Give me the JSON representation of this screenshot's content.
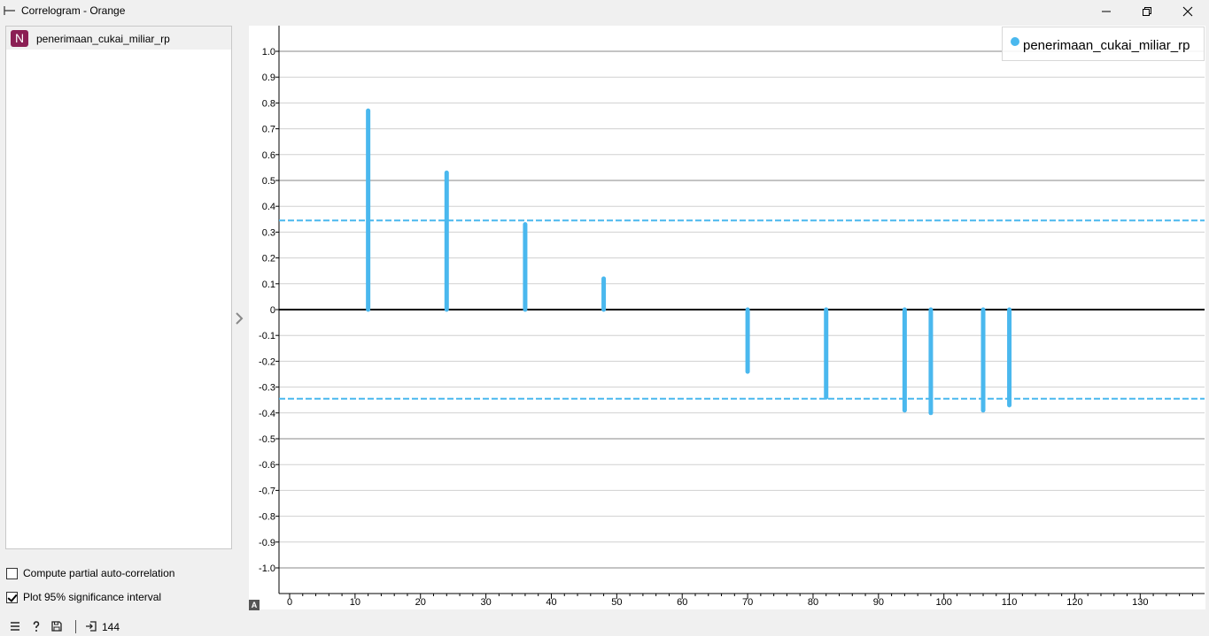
{
  "window": {
    "title": "Correlogram - Orange"
  },
  "sidebar": {
    "variables": [
      {
        "badge": "N",
        "label": "penerimaan_cukai_miliar_rp"
      }
    ],
    "options": [
      {
        "label": "Compute partial auto-correlation",
        "checked": false
      },
      {
        "label": "Plot 95% significance interval",
        "checked": true
      }
    ]
  },
  "legend": {
    "label": "penerimaan_cukai_miliar_rp",
    "color": "#4ab8ee"
  },
  "statusbar": {
    "count": "144"
  },
  "chart_data": {
    "type": "bar",
    "series": [
      {
        "name": "penerimaan_cukai_miliar_rp",
        "x": [
          12,
          24,
          36,
          48,
          70,
          82,
          94,
          98,
          106,
          110
        ],
        "values": [
          0.77,
          0.53,
          0.33,
          0.12,
          -0.24,
          -0.34,
          -0.39,
          -0.4,
          -0.39,
          -0.37
        ]
      }
    ],
    "significance": 0.345,
    "xlim": [
      -2,
      139
    ],
    "ylim": [
      -1.1,
      1.1
    ],
    "xticks": [
      0,
      10,
      20,
      30,
      40,
      50,
      60,
      70,
      80,
      90,
      100,
      110,
      120,
      130
    ],
    "yticks": [
      "1.0",
      "0.9",
      "0.8",
      "0.7",
      "0.6",
      "0.5",
      "0.4",
      "0.3",
      "0.2",
      "0.1",
      "0",
      "-0.1",
      "-0.2",
      "-0.3",
      "-0.4",
      "-0.5",
      "-0.6",
      "-0.7",
      "-0.8",
      "-0.9",
      "-1.0"
    ],
    "ytick_values": [
      1.0,
      0.9,
      0.8,
      0.7,
      0.6,
      0.5,
      0.4,
      0.3,
      0.2,
      0.1,
      0,
      -0.1,
      -0.2,
      -0.3,
      -0.4,
      -0.5,
      -0.6,
      -0.7,
      -0.8,
      -0.9,
      -1.0
    ],
    "grid": true,
    "legend_position": "top-right",
    "bar_color": "#4ab8ee",
    "interval_color": "#4ab8ee"
  }
}
